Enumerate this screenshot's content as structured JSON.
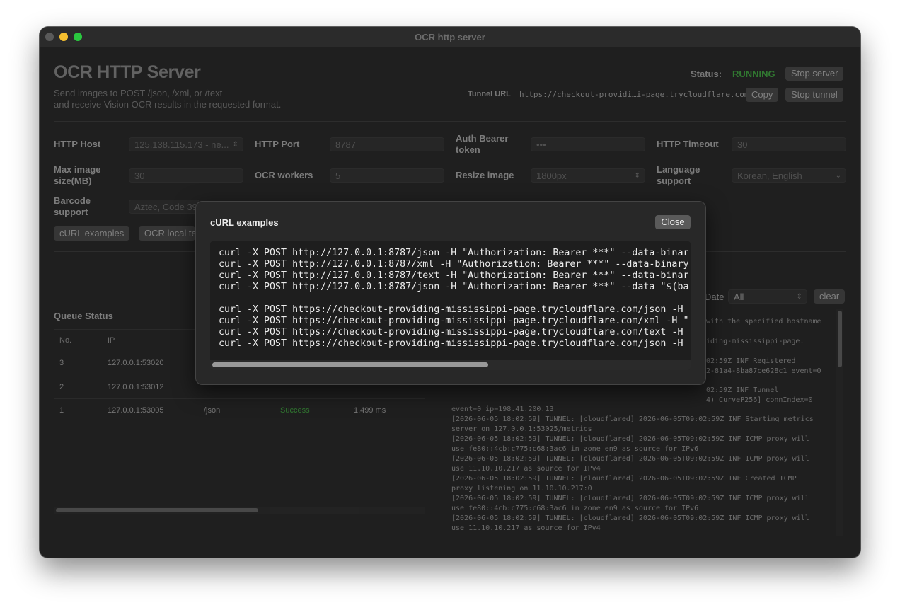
{
  "window": {
    "title": "OCR http server"
  },
  "header": {
    "title": "OCR HTTP Server",
    "subtitle_line1": "Send images to POST /json, /xml, or /text",
    "subtitle_line2": "and receive Vision OCR results in the requested format.",
    "status_label": "Status:",
    "status_value": "RUNNING",
    "stop_server": "Stop server",
    "tunnel_label": "Tunnel URL",
    "tunnel_url": "https://checkout-providi…i-page.trycloudflare.com",
    "copy": "Copy",
    "stop_tunnel": "Stop tunnel"
  },
  "settings": {
    "host_label": "HTTP Host",
    "host_value": "125.138.115.173 - ne...",
    "port_label": "HTTP Port",
    "port_value": "8787",
    "auth_label_1": "Auth Bearer",
    "auth_label_2": "token",
    "auth_value": "•••",
    "timeout_label": "HTTP Timeout",
    "timeout_value": "30",
    "max_label_1": "Max image",
    "max_label_2": "size(MB)",
    "max_value": "30",
    "workers_label": "OCR workers",
    "workers_value": "5",
    "resize_label": "Resize image",
    "resize_value": "1800px",
    "lang_label_1": "Language",
    "lang_label_2": "support",
    "lang_value": "Korean, English",
    "barcode_label_1": "Barcode",
    "barcode_label_2": "support",
    "barcode_value": "Aztec, Code 39",
    "curl_examples_btn": "cURL examples",
    "ocr_local_btn": "OCR local te"
  },
  "queue": {
    "title": "Queue Status",
    "columns": [
      "No.",
      "IP"
    ],
    "rows": [
      {
        "no": "3",
        "ip": "127.0.0.1:53020"
      },
      {
        "no": "2",
        "ip": "127.0.0.1:53012"
      },
      {
        "no": "1",
        "ip": "127.0.0.1:53005",
        "path": "/json",
        "result": "Success",
        "time": "1,499 ms"
      }
    ]
  },
  "log": {
    "date_label": "Date",
    "filter_value": "All",
    "clear": "clear",
    "lines": [
      "with the specified hostname",
      "iding-mississippi-page.",
      "02:59Z INF Registered",
      "2-81a4-8ba87ce628c1 event=0",
      "02:59Z INF Tunnel",
      "4) CurveP256] connIndex=0",
      "event=0 ip=198.41.200.13",
      "[2026-06-05 18:02:59] TUNNEL: [cloudflared] 2026-06-05T09:02:59Z INF Starting metrics",
      "server on 127.0.0.1:53025/metrics",
      "[2026-06-05 18:02:59] TUNNEL: [cloudflared] 2026-06-05T09:02:59Z INF ICMP proxy will",
      "use fe80::4cb:c775:c68:3ac6 in zone en9 as source for IPv6",
      "[2026-06-05 18:02:59] TUNNEL: [cloudflared] 2026-06-05T09:02:59Z INF ICMP proxy will",
      "use 11.10.10.217 as source for IPv4",
      "[2026-06-05 18:02:59] TUNNEL: [cloudflared] 2026-06-05T09:02:59Z INF Created ICMP",
      "proxy listening on 11.10.10.217:0",
      "[2026-06-05 18:02:59] TUNNEL: [cloudflared] 2026-06-05T09:02:59Z INF ICMP proxy will",
      "use fe80::4cb:c775:c68:3ac6 in zone en9 as source for IPv6",
      "[2026-06-05 18:02:59] TUNNEL: [cloudflared] 2026-06-05T09:02:59Z INF ICMP proxy will",
      "use 11.10.10.217 as source for IPv4"
    ]
  },
  "modal": {
    "title": "cURL examples",
    "close": "Close",
    "local_lines": [
      "curl -X POST http://127.0.0.1:8787/json -H \"Authorization: Bearer ***\" --data-binar",
      "curl -X POST http://127.0.0.1:8787/xml -H \"Authorization: Bearer ***\" --data-binary",
      "curl -X POST http://127.0.0.1:8787/text -H \"Authorization: Bearer ***\" --data-binar",
      "curl -X POST http://127.0.0.1:8787/json -H \"Authorization: Bearer ***\" --data \"$(ba"
    ],
    "tunnel_lines": [
      "curl -X POST https://checkout-providing-mississippi-page.trycloudflare.com/json -H",
      "curl -X POST https://checkout-providing-mississippi-page.trycloudflare.com/xml -H \"",
      "curl -X POST https://checkout-providing-mississippi-page.trycloudflare.com/text -H",
      "curl -X POST https://checkout-providing-mississippi-page.trycloudflare.com/json -H"
    ]
  },
  "icons": {
    "chevron": "⌃⌄",
    "dropdown": "⌄"
  }
}
